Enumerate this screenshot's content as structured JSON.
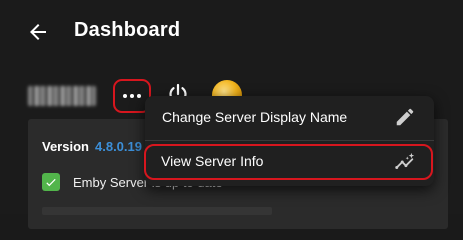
{
  "header": {
    "title": "Dashboard",
    "back_icon": "arrow-left-icon"
  },
  "server": {
    "more_icon": "more-horizontal-icon",
    "power_icon": "power-icon"
  },
  "info_card": {
    "version_label": "Version",
    "version_number": "4.8.0.19",
    "status_text": "Emby Server is up to date",
    "status_icon": "check-icon"
  },
  "menu": {
    "items": [
      {
        "label": "Change Server Display Name",
        "icon": "pencil-icon"
      },
      {
        "label": "View Server Info",
        "icon": "insights-icon"
      }
    ]
  },
  "colors": {
    "background": "#1b1b1b",
    "card": "#2b2b2b",
    "menu": "#202020",
    "highlight_outline": "#d7161e",
    "accent_link": "#3c8fd8",
    "success": "#52b54b",
    "avatar": "#f2b51f"
  }
}
